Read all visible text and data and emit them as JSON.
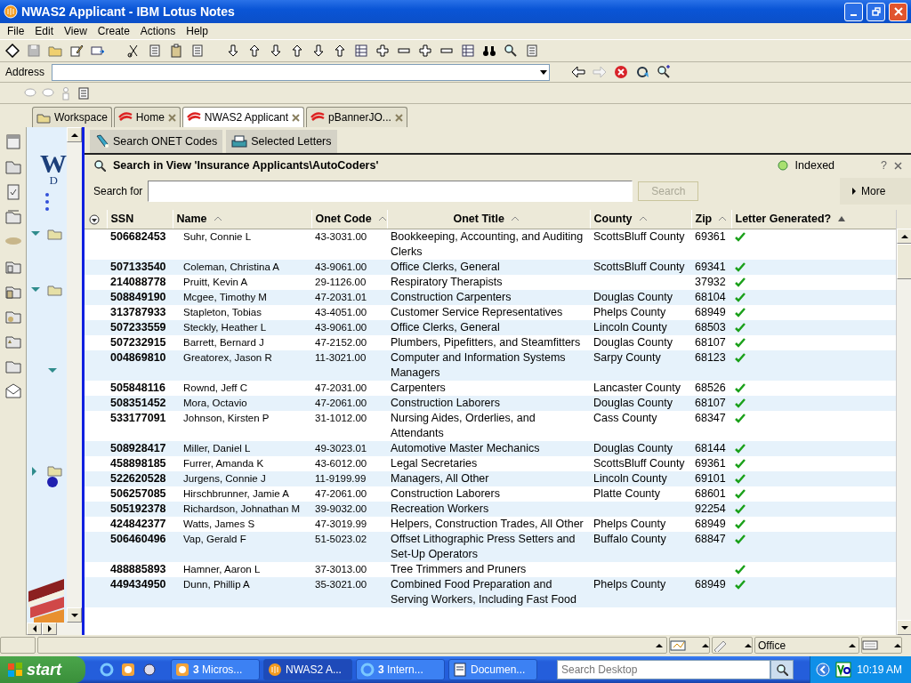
{
  "window": {
    "title": "NWAS2 Applicant - IBM Lotus Notes"
  },
  "menu": [
    "File",
    "Edit",
    "View",
    "Create",
    "Actions",
    "Help"
  ],
  "address": {
    "label": "Address"
  },
  "tabs": [
    {
      "label": "Workspace",
      "selected": false,
      "closable": false
    },
    {
      "label": "Home",
      "selected": false,
      "closable": true
    },
    {
      "label": "NWAS2 Applicant",
      "selected": true,
      "closable": true
    },
    {
      "label": "pBannerJO...",
      "selected": false,
      "closable": true
    }
  ],
  "nav": {
    "logo": "W",
    "logo_sub": "D"
  },
  "actions": [
    "Search ONET Codes",
    "Selected Letters"
  ],
  "search": {
    "title": "Search in View 'Insurance Applicants\\AutoCoders'",
    "status": "Indexed",
    "help": "?",
    "label": "Search for",
    "button": "Search",
    "more": "More"
  },
  "table": {
    "columns": [
      {
        "label": "SSN",
        "sortable": false,
        "sorted": false
      },
      {
        "label": "Name",
        "sortable": true,
        "sorted": false
      },
      {
        "label": "Onet Code",
        "sortable": true,
        "sorted": false
      },
      {
        "label": "Onet Title",
        "sortable": true,
        "sorted": false
      },
      {
        "label": "County",
        "sortable": true,
        "sorted": false
      },
      {
        "label": "Zip",
        "sortable": true,
        "sorted": false
      },
      {
        "label": "Letter Generated?",
        "sortable": true,
        "sorted": true
      }
    ],
    "rows": [
      {
        "ssn": "506682453",
        "name": "Suhr, Connie L",
        "onet_code": "43-3031.00",
        "onet_title": "Bookkeeping, Accounting, and Auditing Clerks",
        "county": "ScottsBluff County",
        "zip": "69361",
        "letter_generated": true
      },
      {
        "ssn": "507133540",
        "name": "Coleman, Christina A",
        "onet_code": "43-9061.00",
        "onet_title": "Office Clerks, General",
        "county": "ScottsBluff County",
        "zip": "69341",
        "letter_generated": true
      },
      {
        "ssn": "214088778",
        "name": "Pruitt, Kevin A",
        "onet_code": "29-1126.00",
        "onet_title": "Respiratory Therapists",
        "zip": "37932",
        "letter_generated": true
      },
      {
        "ssn": "508849190",
        "name": "Mcgee, Timothy M",
        "onet_code": "47-2031.01",
        "onet_title": "Construction Carpenters",
        "county": "Douglas County",
        "zip": "68104",
        "letter_generated": true
      },
      {
        "ssn": "313787933",
        "name": "Stapleton, Tobias",
        "onet_code": "43-4051.00",
        "onet_title": "Customer Service Representatives",
        "county": "Phelps County",
        "zip": "68949",
        "letter_generated": true
      },
      {
        "ssn": "507233559",
        "name": "Steckly, Heather L",
        "onet_code": "43-9061.00",
        "onet_title": "Office Clerks, General",
        "county": "Lincoln County",
        "zip": "68503",
        "letter_generated": true
      },
      {
        "ssn": "507232915",
        "name": "Barrett, Bernard J",
        "onet_code": "47-2152.00",
        "onet_title": "Plumbers, Pipefitters, and Steamfitters",
        "county": "Douglas County",
        "zip": "68107",
        "letter_generated": true
      },
      {
        "ssn": "004869810",
        "name": "Greatorex, Jason R",
        "onet_code": "11-3021.00",
        "onet_title": "Computer and Information Systems Managers",
        "county": "Sarpy County",
        "zip": "68123",
        "letter_generated": true
      },
      {
        "ssn": "505848116",
        "name": "Rownd, Jeff C",
        "onet_code": "47-2031.00",
        "onet_title": "Carpenters",
        "county": "Lancaster County",
        "zip": "68526",
        "letter_generated": true
      },
      {
        "ssn": "508351452",
        "name": "Mora, Octavio",
        "onet_code": "47-2061.00",
        "onet_title": "Construction Laborers",
        "county": "Douglas County",
        "zip": "68107",
        "letter_generated": true
      },
      {
        "ssn": "533177091",
        "name": "Johnson, Kirsten P",
        "onet_code": "31-1012.00",
        "onet_title": "Nursing Aides, Orderlies, and Attendants",
        "county": "Cass County",
        "zip": "68347",
        "letter_generated": true
      },
      {
        "ssn": "508928417",
        "name": "Miller, Daniel L",
        "onet_code": "49-3023.01",
        "onet_title": "Automotive Master Mechanics",
        "county": "Douglas County",
        "zip": "68144",
        "letter_generated": true
      },
      {
        "ssn": "458898185",
        "name": "Furrer, Amanda K",
        "onet_code": "43-6012.00",
        "onet_title": "Legal Secretaries",
        "county": "ScottsBluff County",
        "zip": "69361",
        "letter_generated": true
      },
      {
        "ssn": "522620528",
        "name": "Jurgens, Connie J",
        "onet_code": "11-9199.99",
        "onet_title": "Managers, All Other",
        "county": "Lincoln County",
        "zip": "69101",
        "letter_generated": true
      },
      {
        "ssn": "506257085",
        "name": "Hirschbrunner, Jamie A",
        "onet_code": "47-2061.00",
        "onet_title": "Construction Laborers",
        "county": "Platte County",
        "zip": "68601",
        "letter_generated": true
      },
      {
        "ssn": "505192378",
        "name": "Richardson, Johnathan M",
        "onet_code": "39-9032.00",
        "onet_title": "Recreation Workers",
        "zip": "92254",
        "letter_generated": true
      },
      {
        "ssn": "424842377",
        "name": "Watts, James S",
        "onet_code": "47-3019.99",
        "onet_title": "Helpers, Construction Trades, All Other",
        "county": "Phelps County",
        "zip": "68949",
        "letter_generated": true
      },
      {
        "ssn": "506460496",
        "name": "Vap, Gerald F",
        "onet_code": "51-5023.02",
        "onet_title": "Offset Lithographic Press Setters and Set-Up Operators",
        "county": "Buffalo County",
        "zip": "68847",
        "letter_generated": true
      },
      {
        "ssn": "488885893",
        "name": "Hamner, Aaron L",
        "onet_code": "37-3013.00",
        "onet_title": "Tree Trimmers and Pruners",
        "letter_generated": true
      },
      {
        "ssn": "449434950",
        "name": "Dunn, Phillip A",
        "onet_code": "35-3021.00",
        "onet_title": "Combined Food Preparation and Serving Workers, Including Fast Food",
        "county": "Phelps County",
        "zip": "68949",
        "letter_generated": true
      }
    ]
  },
  "status_bar": {
    "location": "Office"
  },
  "taskbar": {
    "start": "start",
    "tasks": [
      {
        "label": "**3** Micros...",
        "selected": false
      },
      {
        "label": "NWAS2 A...",
        "selected": true
      },
      {
        "label": "**3** Intern...",
        "selected": false
      },
      {
        "label": "Documen...",
        "selected": false
      }
    ],
    "search_placeholder": "Search Desktop",
    "clock": "10:19 AM"
  }
}
